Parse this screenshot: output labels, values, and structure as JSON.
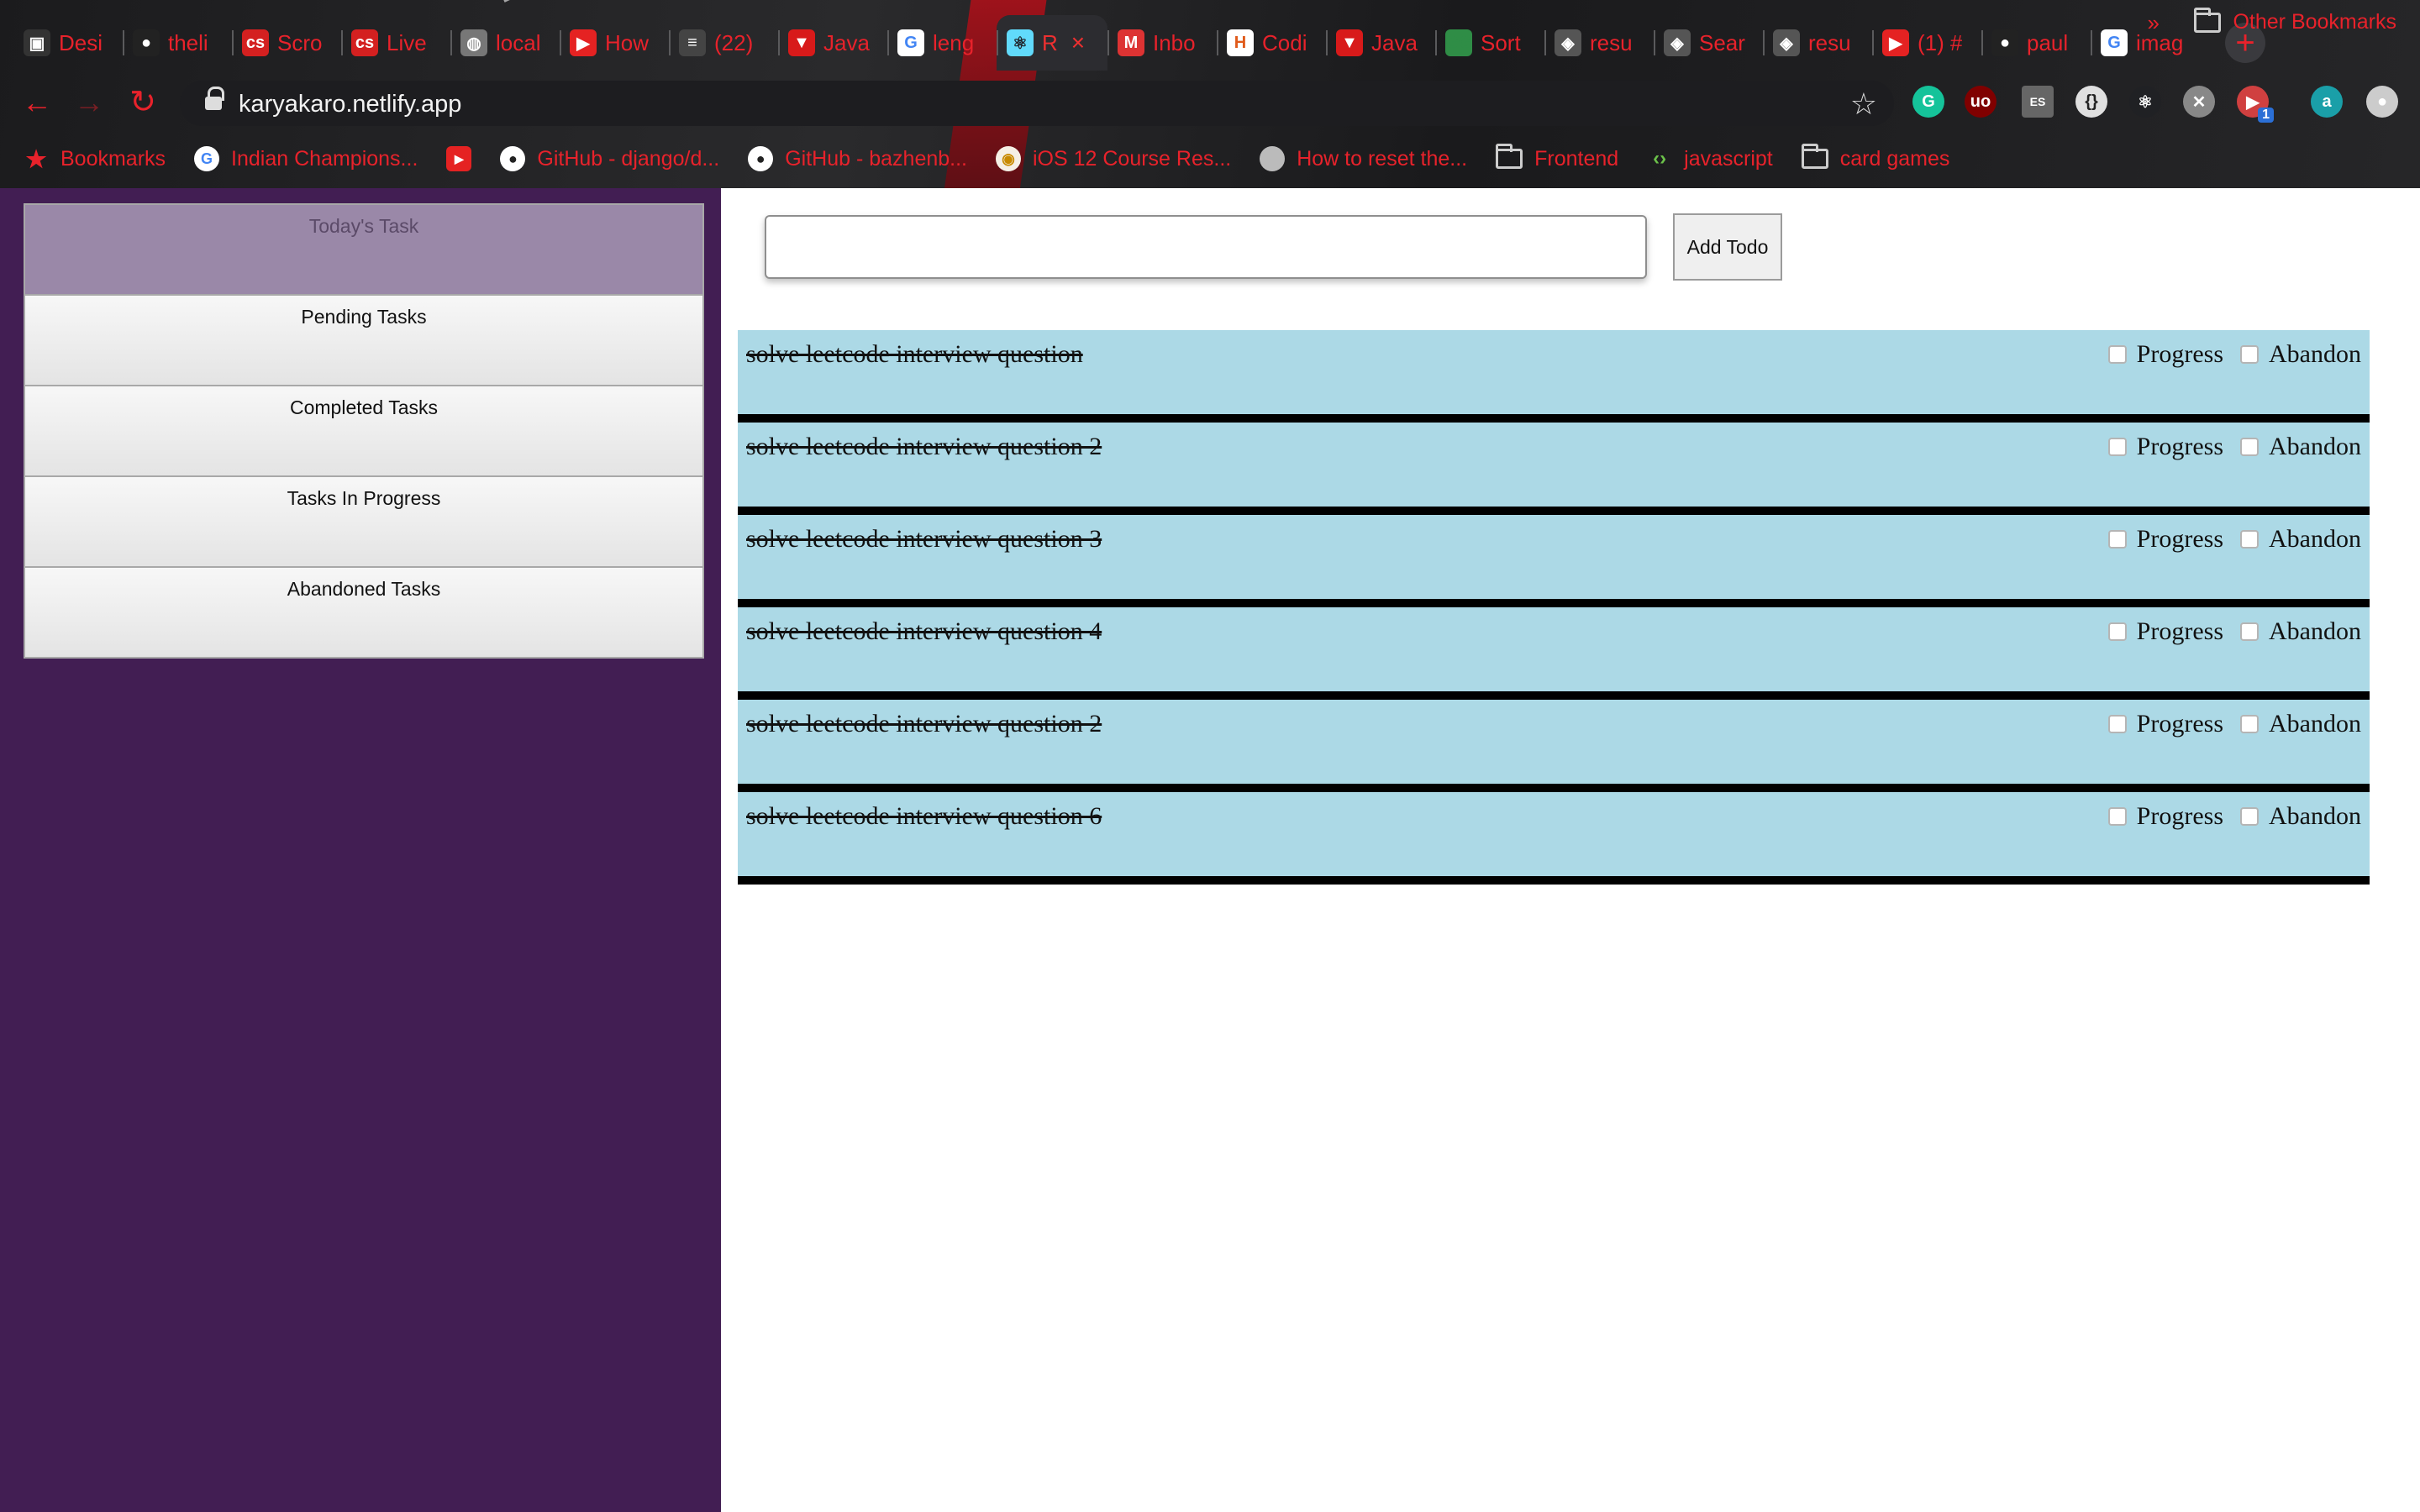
{
  "browser": {
    "tabs": [
      {
        "label": "Desi",
        "icon": "terminal-icon",
        "color": "#333333"
      },
      {
        "label": "theli",
        "icon": "github-icon",
        "color": "#222222"
      },
      {
        "label": "Scro",
        "icon": "codesandbox-icon",
        "color": "#d42020"
      },
      {
        "label": "Live",
        "icon": "codesandbox-icon",
        "color": "#d42020"
      },
      {
        "label": "local",
        "icon": "globe-icon",
        "color": "#777777"
      },
      {
        "label": "How",
        "icon": "youtube-icon",
        "color": "#e52222"
      },
      {
        "label": "(22)",
        "icon": "stackoverflow-icon",
        "color": "#444444"
      },
      {
        "label": "Java",
        "icon": "vivaldi-icon",
        "color": "#d81a1a"
      },
      {
        "label": "leng",
        "icon": "google-icon",
        "color": "#ffffff"
      },
      {
        "label": "R",
        "icon": "react-icon",
        "color": "#61dafb",
        "active": true
      },
      {
        "label": "Inbo",
        "icon": "gmail-icon",
        "color": "#dd3333"
      },
      {
        "label": "Codi",
        "icon": "hackerrank-icon",
        "color": "#ffffff"
      },
      {
        "label": "Java",
        "icon": "vivaldi-icon",
        "color": "#d81a1a"
      },
      {
        "label": "Sort",
        "icon": "geeksforgeeks-icon",
        "color": "#2f8d46"
      },
      {
        "label": "resu",
        "icon": "cube-icon",
        "color": "#555555"
      },
      {
        "label": "Sear",
        "icon": "cube-icon",
        "color": "#555555"
      },
      {
        "label": "resu",
        "icon": "cube-icon",
        "color": "#555555"
      },
      {
        "label": "(1) #",
        "icon": "youtube-icon",
        "color": "#e52222"
      },
      {
        "label": "paul",
        "icon": "github-icon",
        "color": "#222222"
      },
      {
        "label": "imag",
        "icon": "google-icon",
        "color": "#ffffff"
      }
    ],
    "url": "karyakaro.netlify.app",
    "extensions": [
      {
        "name": "grammarly-icon",
        "glyph": "G",
        "color": "#15c39a"
      },
      {
        "name": "ublock-icon",
        "glyph": "uo",
        "color": "#800000"
      },
      {
        "name": "es-icon",
        "glyph": "ES",
        "color": "#666666"
      },
      {
        "name": "json-icon",
        "glyph": "{}",
        "color": "#e0e0e0"
      },
      {
        "name": "react-devtools-icon",
        "glyph": "⚛",
        "color": "#202124"
      },
      {
        "name": "close-ext-icon",
        "glyph": "✕",
        "color": "#888888"
      },
      {
        "name": "screen-capture-icon",
        "glyph": "▶",
        "color": "#d04040"
      },
      {
        "name": "profile-avatar-icon",
        "glyph": "a",
        "color": "#1a9fa8"
      },
      {
        "name": "more-icon",
        "glyph": "●",
        "color": "#cccccc"
      }
    ],
    "extension_badge": "1",
    "bookmarks": [
      {
        "label": "Bookmarks",
        "icon": "star-icon"
      },
      {
        "label": "Indian Champions...",
        "icon": "google-icon"
      },
      {
        "label": "",
        "icon": "youtube-icon"
      },
      {
        "label": "GitHub - django/d...",
        "icon": "github-icon"
      },
      {
        "label": "GitHub - bazhenb...",
        "icon": "github-icon"
      },
      {
        "label": "iOS 12 Course Res...",
        "icon": "ios-course-icon"
      },
      {
        "label": "How to reset the...",
        "icon": "apple-icon"
      },
      {
        "label": "Frontend",
        "icon": "folder-icon"
      },
      {
        "label": "javascript",
        "icon": "code-icon"
      },
      {
        "label": "card games",
        "icon": "folder-icon"
      }
    ],
    "other_bookmarks": "Other Bookmarks"
  },
  "sidebar": {
    "items": [
      {
        "label": "Today's Task",
        "active": true
      },
      {
        "label": "Pending Tasks"
      },
      {
        "label": "Completed Tasks"
      },
      {
        "label": "Tasks In Progress"
      },
      {
        "label": "Abandoned Tasks"
      }
    ]
  },
  "form": {
    "input_value": "",
    "input_placeholder": "",
    "add_label": "Add Todo"
  },
  "todos": [
    {
      "text": "solve leetcode interview question",
      "progress": "Progress",
      "abandon": "Abandon"
    },
    {
      "text": "solve leetcode interview question 2",
      "progress": "Progress",
      "abandon": "Abandon"
    },
    {
      "text": "solve leetcode interview question 3",
      "progress": "Progress",
      "abandon": "Abandon"
    },
    {
      "text": "solve leetcode interview question 4",
      "progress": "Progress",
      "abandon": "Abandon"
    },
    {
      "text": "solve leetcode interview question 2",
      "progress": "Progress",
      "abandon": "Abandon"
    },
    {
      "text": "solve leetcode interview question 6",
      "progress": "Progress",
      "abandon": "Abandon"
    }
  ],
  "colors": {
    "sidebar_bg": "#421e53",
    "todo_bg": "#acd9e6",
    "active_menu_bg": "#9a88a8",
    "chrome_accent": "#e8222b"
  }
}
